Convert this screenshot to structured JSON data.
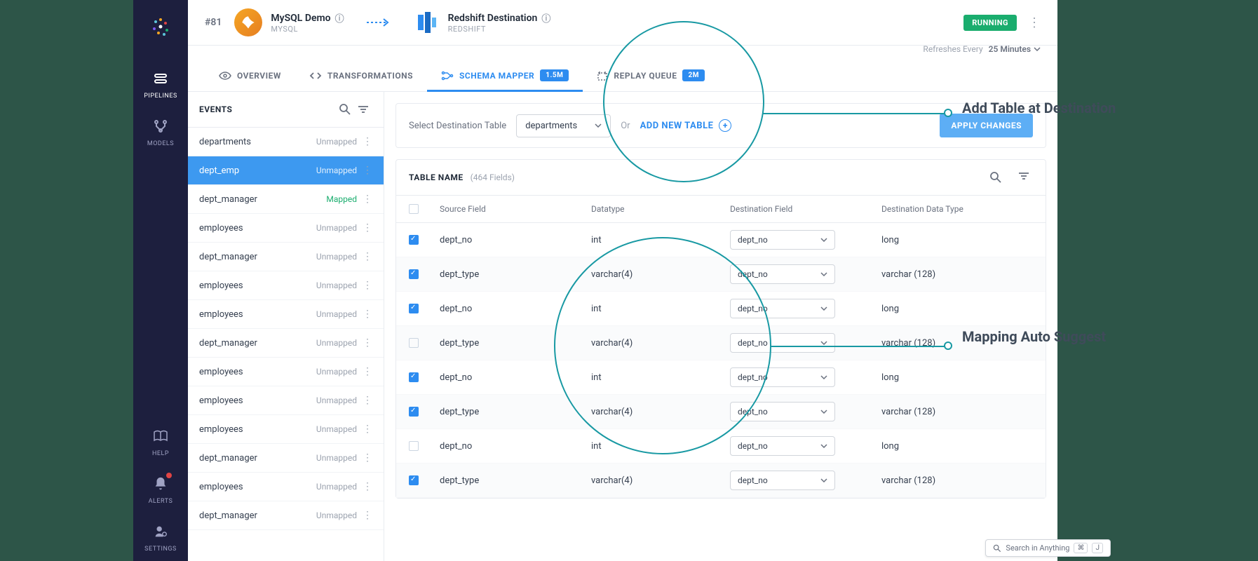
{
  "nav": {
    "items": [
      {
        "label": "PIPELINES",
        "icon": "pipelines"
      },
      {
        "label": "MODELS",
        "icon": "models"
      }
    ],
    "bottom": [
      {
        "label": "HELP",
        "icon": "help"
      },
      {
        "label": "ALERTS",
        "icon": "alerts"
      },
      {
        "label": "SETTINGS",
        "icon": "settings"
      }
    ]
  },
  "header": {
    "pipeline_id": "#81",
    "source": {
      "title": "MySQL Demo",
      "subtitle": "MYSQL"
    },
    "destination": {
      "title": "Redshift Destination",
      "subtitle": "REDSHIFT"
    },
    "status": "RUNNING",
    "refresh_label": "Refreshes Every",
    "refresh_value": "25 Minutes"
  },
  "tabs": [
    {
      "label": "OVERVIEW",
      "icon": "eye"
    },
    {
      "label": "TRANSFORMATIONS",
      "icon": "code"
    },
    {
      "label": "SCHEMA MAPPER",
      "icon": "schema",
      "badge": "1.5M",
      "active": true
    },
    {
      "label": "REPLAY QUEUE",
      "icon": "replay",
      "badge": "2M"
    }
  ],
  "events": {
    "title": "EVENTS",
    "items": [
      {
        "name": "departments",
        "status": "Unmapped"
      },
      {
        "name": "dept_emp",
        "status": "Unmapped",
        "selected": true
      },
      {
        "name": "dept_manager",
        "status": "Mapped",
        "mapped": true
      },
      {
        "name": "employees",
        "status": "Unmapped"
      },
      {
        "name": "dept_manager",
        "status": "Unmapped"
      },
      {
        "name": "employees",
        "status": "Unmapped"
      },
      {
        "name": "employees",
        "status": "Unmapped"
      },
      {
        "name": "dept_manager",
        "status": "Unmapped"
      },
      {
        "name": "employees",
        "status": "Unmapped"
      },
      {
        "name": "employees",
        "status": "Unmapped"
      },
      {
        "name": "employees",
        "status": "Unmapped"
      },
      {
        "name": "dept_manager",
        "status": "Unmapped"
      },
      {
        "name": "employees",
        "status": "Unmapped"
      },
      {
        "name": "dept_manager",
        "status": "Unmapped"
      }
    ]
  },
  "dest_bar": {
    "label": "Select Destination Table",
    "selected": "departments",
    "or": "Or",
    "add_new": "ADD NEW TABLE",
    "apply": "APPLY CHANGES"
  },
  "table": {
    "name_label": "TABLE NAME",
    "fields_count": "(464 Fields)",
    "columns": {
      "source": "Source Field",
      "datatype": "Datatype",
      "dest_field": "Destination Field",
      "dest_type": "Destination Data Type"
    },
    "rows": [
      {
        "checked": true,
        "source": "dept_no",
        "datatype": "int",
        "dest_field": "dept_no",
        "dest_type": "long"
      },
      {
        "checked": true,
        "source": "dept_type",
        "datatype": "varchar(4)",
        "dest_field": "dept_no",
        "dest_type": "varchar (128)"
      },
      {
        "checked": true,
        "source": "dept_no",
        "datatype": "int",
        "dest_field": "dept_no",
        "dest_type": "long"
      },
      {
        "checked": false,
        "source": "dept_type",
        "datatype": "varchar(4)",
        "dest_field": "dept_no",
        "dest_type": "varchar (128)"
      },
      {
        "checked": true,
        "source": "dept_no",
        "datatype": "int",
        "dest_field": "dept_no",
        "dest_type": "long"
      },
      {
        "checked": true,
        "source": "dept_type",
        "datatype": "varchar(4)",
        "dest_field": "dept_no",
        "dest_type": "varchar (128)"
      },
      {
        "checked": false,
        "source": "dept_no",
        "datatype": "int",
        "dest_field": "dept_no",
        "dest_type": "long"
      },
      {
        "checked": true,
        "source": "dept_type",
        "datatype": "varchar(4)",
        "dest_field": "dept_no",
        "dest_type": "varchar (128)"
      }
    ]
  },
  "annotations": {
    "add_table": "Add Table at Destination",
    "auto_suggest": "Mapping Auto Suggest"
  },
  "search_bar": {
    "placeholder": "Search in Anything",
    "kbd1": "⌘",
    "kbd2": "J"
  }
}
